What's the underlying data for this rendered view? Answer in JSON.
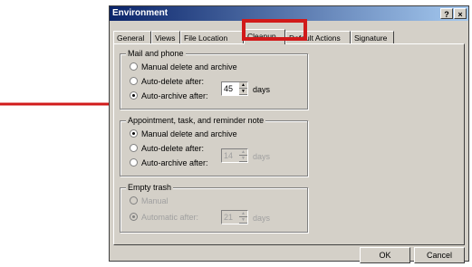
{
  "dialog": {
    "title": "Environment",
    "help_btn": "?",
    "close_btn": "×"
  },
  "tabs": [
    "General",
    "Views",
    "File Location",
    "Cleanup",
    "Default Actions",
    "Signature"
  ],
  "mail": {
    "label": "Mail and phone",
    "opt1": "Manual delete and archive",
    "opt2": "Auto-delete after:",
    "opt3": "Auto-archive after:",
    "days_value": "45",
    "days_unit": "days"
  },
  "appt": {
    "label": "Appointment, task, and reminder note",
    "opt1": "Manual delete and archive",
    "opt2": "Auto-delete after:",
    "opt3": "Auto-archive after:",
    "days_value": "14",
    "days_unit": "days"
  },
  "trash": {
    "label": "Empty trash",
    "opt1": "Manual",
    "opt2": "Automatic after:",
    "days_value": "21",
    "days_unit": "days"
  },
  "buttons": {
    "ok": "OK",
    "cancel": "Cancel"
  },
  "annotations": {
    "arrow_color": "#d11a1a",
    "highlight_color": "#d11a1a"
  }
}
